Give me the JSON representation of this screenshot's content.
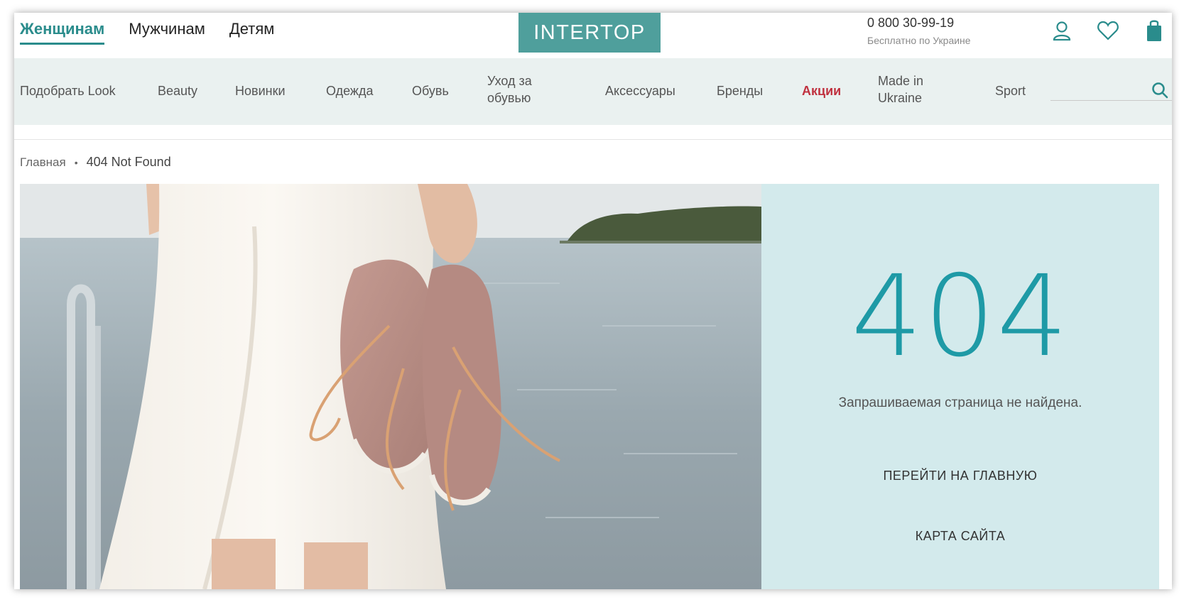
{
  "header": {
    "gender_tabs": [
      {
        "label": "Женщинам",
        "active": true
      },
      {
        "label": "Мужчинам",
        "active": false
      },
      {
        "label": "Детям",
        "active": false
      }
    ],
    "logo_text": "INTERTOP",
    "phone": "0 800 30-99-19",
    "phone_note": "Бесплатно по Украине",
    "icons": [
      "user-icon",
      "heart-icon",
      "shopping-bag-icon"
    ]
  },
  "nav": {
    "items": [
      {
        "label": "Подобрать Look"
      },
      {
        "label": "Beauty"
      },
      {
        "label": "Новинки"
      },
      {
        "label": "Одежда"
      },
      {
        "label": "Обувь"
      },
      {
        "label": "Уход за обувью"
      },
      {
        "label": "Аксессуары"
      },
      {
        "label": "Бренды"
      },
      {
        "label": "Акции"
      },
      {
        "label": "Made in Ukraine"
      },
      {
        "label": "Sport"
      }
    ],
    "search_value": ""
  },
  "breadcrumb": {
    "home": "Главная",
    "separator": "•",
    "current": "404 Not Found"
  },
  "error": {
    "code": "404",
    "message": "Запрашиваемая страница не найдена.",
    "home_link": "ПЕРЕЙТИ НА ГЛАВНУЮ",
    "sitemap_link": "КАРТА САЙТА"
  },
  "colors": {
    "brand_teal": "#4f9f9c",
    "accent_teal": "#1e9aa6",
    "nav_bg": "#eaf1f0",
    "panel_bg": "#d3eaec",
    "sale_red": "#c0313f"
  }
}
